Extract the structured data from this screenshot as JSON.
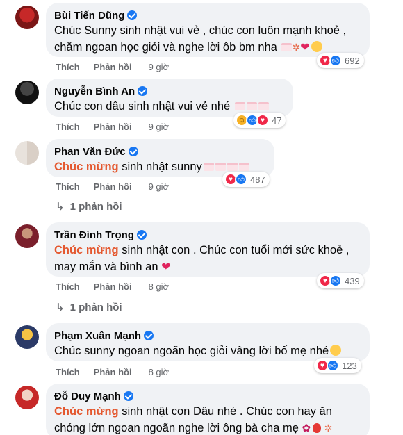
{
  "comments": [
    {
      "name": "Bùi Tiến Dũng",
      "line1": "Chúc Sunny sinh nhật vui vẻ , chúc con luôn mạnh khoẻ ,",
      "line2": "chăm ngoan học giỏi và nghe lời ôb bm nha",
      "like": "Thích",
      "reply": "Phản hồi",
      "time": "9 giờ",
      "reactions": [
        "heart",
        "like"
      ],
      "count": "692"
    },
    {
      "name": "Nguyễn Bình An",
      "line1": "Chúc con dâu sinh nhật vui vẻ nhé",
      "like": "Thích",
      "reply": "Phản hồi",
      "time": "9 giờ",
      "reactions": [
        "haha",
        "like",
        "heart"
      ],
      "count": "47"
    },
    {
      "name": "Phan Văn Đức",
      "highlight": "Chúc mừng",
      "line1": " sinh nhật sunny",
      "like": "Thích",
      "reply": "Phản hồi",
      "time": "9 giờ",
      "reactions": [
        "heart",
        "like"
      ],
      "count": "487",
      "replies": "1 phản hồi"
    },
    {
      "name": "Trần Đình Trọng",
      "highlight": "Chúc mừng",
      "line1": " sinh nhật con . Chúc con tuổi mới sức khoẻ ,",
      "line2": "may mắn và bình an",
      "like": "Thích",
      "reply": "Phản hồi",
      "time": "8 giờ",
      "reactions": [
        "heart",
        "like"
      ],
      "count": "439",
      "replies": "1 phản hồi"
    },
    {
      "name": "Phạm Xuân Mạnh",
      "line1": "Chúc sunny ngoan ngoãn học giỏi vâng lời bố mẹ nhé",
      "like": "Thích",
      "reply": "Phản hồi",
      "time": "8 giờ",
      "reactions": [
        "heart",
        "like"
      ],
      "count": "123"
    },
    {
      "name": "Đỗ Duy Mạnh",
      "highlight": "Chúc mừng",
      "line1": " sinh nhật con Dâu nhé . Chúc con hay ăn",
      "line2": "chóng lớn ngoan ngoãn nghe lời ông bà cha mẹ"
    }
  ],
  "colors": {
    "verified": "#1877f2",
    "highlight": "#e4572e",
    "heart": "#f02849",
    "like": "#1877f2"
  }
}
